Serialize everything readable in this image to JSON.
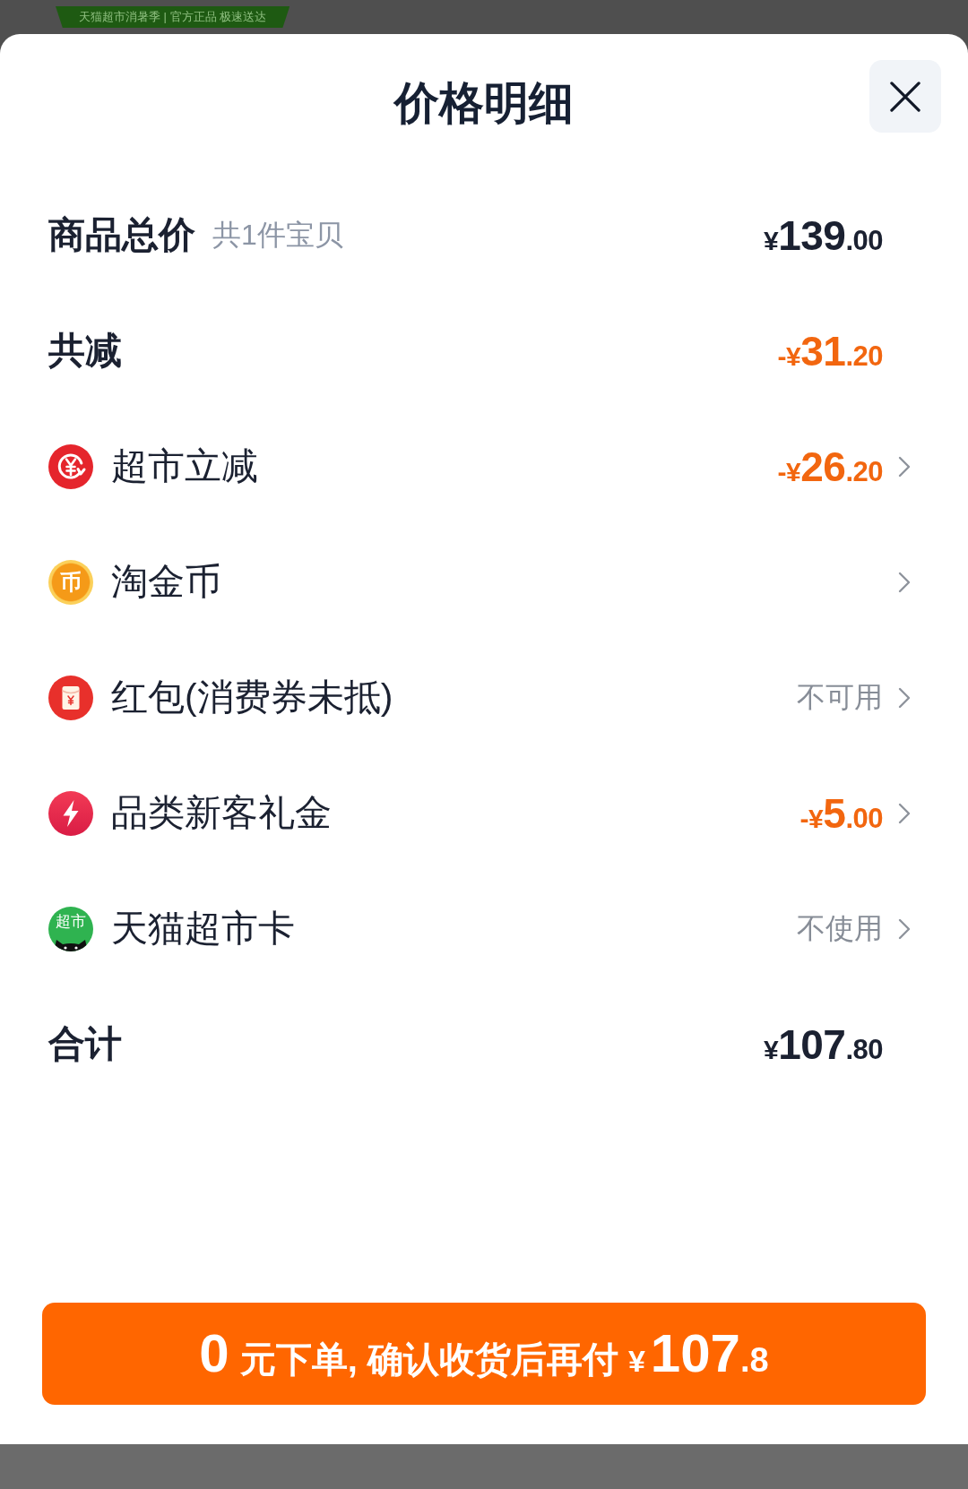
{
  "backdrop": {
    "banner": "天猫超市消暑季 | 官方正品 极速送达"
  },
  "sheet": {
    "title": "价格明细"
  },
  "subtotal": {
    "label": "商品总价",
    "note": "共1件宝贝",
    "price": {
      "symbol": "¥",
      "main": "139",
      "fraction": ".00"
    }
  },
  "reduction": {
    "label": "共减",
    "price": {
      "symbol": "-¥",
      "main": "31",
      "fraction": ".20"
    }
  },
  "benefits": [
    {
      "label": "超市立减",
      "price": {
        "symbol": "-¥",
        "main": "26",
        "fraction": ".20"
      }
    },
    {
      "label": "淘金币",
      "icon_text": "币"
    },
    {
      "label": "红包(消费券未抵)",
      "status": "不可用"
    },
    {
      "label": "品类新客礼金",
      "price": {
        "symbol": "-¥",
        "main": "5",
        "fraction": ".00"
      }
    },
    {
      "label": "天猫超市卡",
      "icon_text": "超市",
      "status": "不使用"
    }
  ],
  "total": {
    "label": "合计",
    "price": {
      "symbol": "¥",
      "main": "107",
      "fraction": ".80"
    }
  },
  "pay_button": {
    "lead": "0",
    "text": "元下单, 确认收货后再付",
    "price": {
      "symbol": "¥",
      "main": "107",
      "fraction": ".8"
    }
  }
}
